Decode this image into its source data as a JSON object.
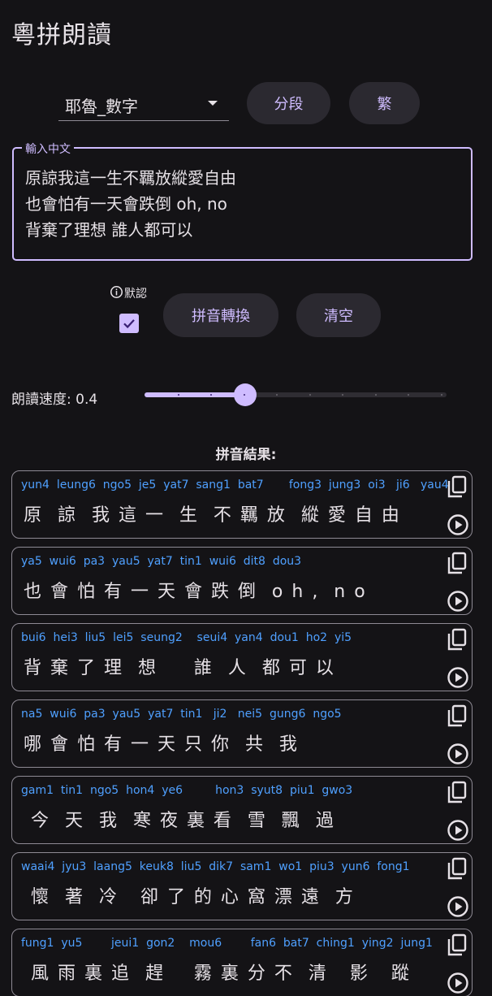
{
  "app": {
    "title": "粵拼朗讀"
  },
  "toolbar": {
    "voice_selected": "耶魯_數字",
    "split_label": "分段",
    "traditional_label": "繁"
  },
  "input": {
    "label": "輸入中文",
    "value": "原諒我這一生不羈放縱愛自由\n也會怕有一天會跌倒 oh, no\n背棄了理想 誰人都可以"
  },
  "options": {
    "default_label": "默認",
    "default_checked": true
  },
  "actions": {
    "convert_label": "拼音轉換",
    "clear_label": "清空"
  },
  "speed": {
    "label": "朗讀速度: 0.4",
    "value": 0.4
  },
  "results": {
    "header": "拼音結果:",
    "cards": [
      {
        "pinyin": "yun4  leung6  ngo5  je5  yat7  sang1  bat7       fong3  jung3  oi3   ji6   yau4",
        "hanzi": "原  諒  我 這 一  生  不 羈 放  縱 愛 自 由"
      },
      {
        "pinyin": "ya5  wui6  pa3  yau5  yat7  tin1  wui6  dit8  dou3",
        "hanzi": "也 會 怕 有 一 天 會 跌 倒  o h ,  n o"
      },
      {
        "pinyin": "bui6  hei3  liu5  lei5  seung2    seui4  yan4  dou1  ho2  yi5",
        "hanzi": "背 棄 了 理  想     誰  人  都 可 以"
      },
      {
        "pinyin": "na5  wui6  pa3  yau5  yat7  tin1   ji2   nei5  gung6  ngo5",
        "hanzi": "哪 會 怕 有 一 天 只 你  共  我"
      },
      {
        "pinyin": "gam1  tin1  ngo5  hon4  ye6         hon3  syut8  piu1  gwo3",
        "hanzi": " 今  天  我  寒 夜 裏 看  雪  飄  過"
      },
      {
        "pinyin": "waai4  jyu3  laang5  keuk8  liu5  dik7  sam1  wo1  piu3  yun6  fong1",
        "hanzi": " 懷  著  冷   卻 了 的 心 窩 漂 遠  方"
      },
      {
        "pinyin": "fung1  yu5        jeui1  gon2    mou6        fan6  bat7  ching1  ying2  jung1",
        "hanzi": " 風 雨 裏 追  趕    霧 裏 分 不  清   影   蹤"
      }
    ]
  },
  "colors": {
    "background": "#141316",
    "accent": "#cfbcff",
    "pinyin": "#4fa0ff",
    "text": "#e6e1e6",
    "outline": "#8e8a94"
  },
  "icons": {
    "dropdown": "arrow-drop-down-icon",
    "info": "info-icon",
    "copy": "copy-icon",
    "play": "play-circle-icon",
    "check": "check-icon"
  }
}
